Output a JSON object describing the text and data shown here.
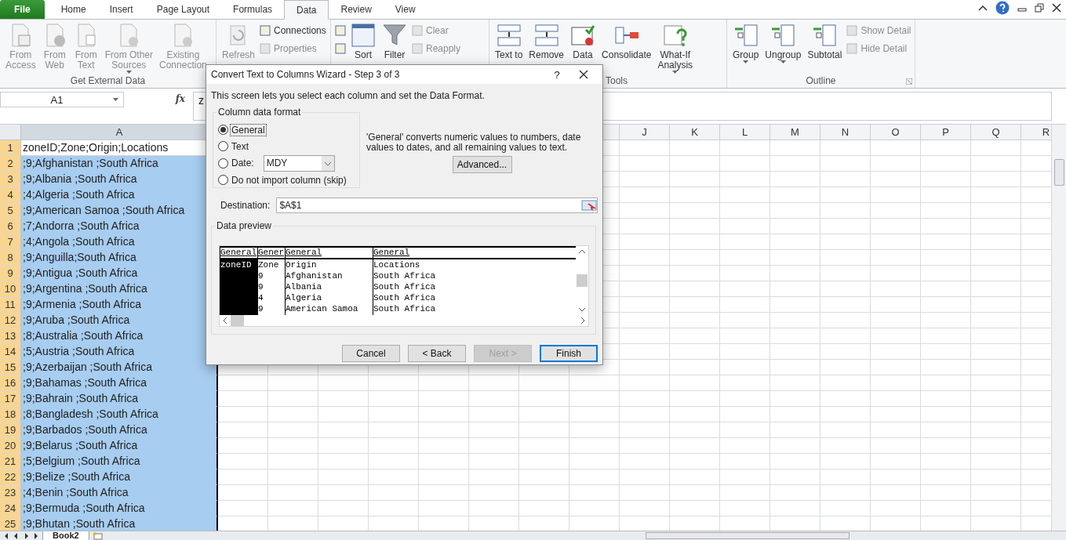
{
  "tabs": [
    {
      "label": "File",
      "kind": "file",
      "selected": false
    },
    {
      "label": "Home",
      "kind": "tab",
      "selected": false
    },
    {
      "label": "Insert",
      "kind": "tab",
      "selected": false
    },
    {
      "label": "Page Layout",
      "kind": "tab",
      "selected": false
    },
    {
      "label": "Formulas",
      "kind": "tab",
      "selected": false
    },
    {
      "label": "Data",
      "kind": "tab",
      "selected": true
    },
    {
      "label": "Review",
      "kind": "tab",
      "selected": false
    },
    {
      "label": "View",
      "kind": "tab",
      "selected": false
    }
  ],
  "ribbon": {
    "groups": [
      {
        "label": "Get External Data",
        "items": [
          {
            "kind": "large",
            "label": "From\nAccess",
            "disabled": true
          },
          {
            "kind": "large",
            "label": "From\nWeb",
            "disabled": true
          },
          {
            "kind": "large",
            "label": "From\nText",
            "disabled": true
          },
          {
            "kind": "large",
            "label": "From Other\nSources",
            "disabled": true,
            "caret": true
          },
          {
            "kind": "large",
            "label": "Existing\nConnection",
            "disabled": true
          }
        ]
      },
      {
        "items": [
          {
            "kind": "large",
            "label": "Refresh",
            "disabled": true
          },
          {
            "kind": "stack",
            "items": [
              {
                "label": "Connections",
                "disabled": false
              },
              {
                "label": "Properties",
                "disabled": true
              }
            ]
          }
        ]
      },
      {
        "items": [
          {
            "kind": "stack",
            "items": [
              {
                "disabled": false
              },
              {
                "disabled": false
              }
            ]
          },
          {
            "kind": "large",
            "label": "Sort",
            "disabled": false
          },
          {
            "kind": "large",
            "label": "Filter",
            "disabled": false
          },
          {
            "kind": "stack",
            "items": [
              {
                "label": "Clear",
                "disabled": true
              },
              {
                "label": "Reapply",
                "disabled": true
              }
            ]
          }
        ]
      },
      {
        "label": "Tools",
        "items": [
          {
            "kind": "large",
            "label": "Text to",
            "disabled": false
          },
          {
            "kind": "large",
            "label": "Remove",
            "disabled": false
          },
          {
            "kind": "large",
            "label": "Data",
            "disabled": false
          },
          {
            "kind": "large",
            "label": "Consolidate",
            "disabled": false
          },
          {
            "kind": "large",
            "label": "What-If\nAnalysis",
            "disabled": false,
            "caret": true
          }
        ]
      },
      {
        "label": "Outline",
        "launcher": true,
        "items": [
          {
            "kind": "large",
            "label": "Group",
            "disabled": false,
            "caret": true
          },
          {
            "kind": "large",
            "label": "Ungroup",
            "disabled": false,
            "caret": true
          },
          {
            "kind": "large",
            "label": "Subtotal",
            "disabled": false
          },
          {
            "kind": "stack",
            "items": [
              {
                "label": "Show Detail",
                "disabled": true
              },
              {
                "label": "Hide Detail",
                "disabled": true
              }
            ]
          }
        ]
      }
    ]
  },
  "formula_bar": {
    "name_box": "A1",
    "fx": "fx",
    "content": "z"
  },
  "columns": [
    {
      "label": "A",
      "selected": true
    },
    {
      "label": "J",
      "selected": false
    },
    {
      "label": "K",
      "selected": false
    },
    {
      "label": "L",
      "selected": false
    },
    {
      "label": "M",
      "selected": false
    },
    {
      "label": "N",
      "selected": false
    },
    {
      "label": "O",
      "selected": false
    },
    {
      "label": "P",
      "selected": false
    },
    {
      "label": "Q",
      "selected": false
    },
    {
      "label": "R",
      "selected": false
    }
  ],
  "rows": [
    {
      "number": "1",
      "value": "zoneID;Zone;Origin;Locations",
      "selected": true,
      "active": true
    },
    {
      "number": "2",
      "value": ";9;Afghanistan ;South Africa",
      "selected": true,
      "active": false
    },
    {
      "number": "3",
      "value": ";9;Albania ;South Africa",
      "selected": true,
      "active": false
    },
    {
      "number": "4",
      "value": ";4;Algeria ;South Africa",
      "selected": true,
      "active": false
    },
    {
      "number": "5",
      "value": ";9;American Samoa ;South Africa",
      "selected": true,
      "active": false
    },
    {
      "number": "6",
      "value": ";7;Andorra ;South Africa",
      "selected": true,
      "active": false
    },
    {
      "number": "7",
      "value": ";4;Angola ;South Africa",
      "selected": true,
      "active": false
    },
    {
      "number": "8",
      "value": ";9;Anguilla;South Africa",
      "selected": true,
      "active": false
    },
    {
      "number": "9",
      "value": ";9;Antigua ;South Africa",
      "selected": true,
      "active": false
    },
    {
      "number": "10",
      "value": ";9;Argentina ;South Africa",
      "selected": true,
      "active": false
    },
    {
      "number": "11",
      "value": ";9;Armenia ;South Africa",
      "selected": true,
      "active": false
    },
    {
      "number": "12",
      "value": ";9;Aruba ;South Africa",
      "selected": true,
      "active": false
    },
    {
      "number": "13",
      "value": ";8;Australia ;South Africa",
      "selected": true,
      "active": false
    },
    {
      "number": "14",
      "value": ";5;Austria ;South Africa",
      "selected": true,
      "active": false
    },
    {
      "number": "15",
      "value": ";9;Azerbaijan ;South Africa",
      "selected": true,
      "active": false
    },
    {
      "number": "16",
      "value": ";9;Bahamas ;South Africa",
      "selected": true,
      "active": false
    },
    {
      "number": "17",
      "value": ";9;Bahrain ;South Africa",
      "selected": true,
      "active": false
    },
    {
      "number": "18",
      "value": ";8;Bangladesh ;South Africa",
      "selected": true,
      "active": false
    },
    {
      "number": "19",
      "value": ";9;Barbados ;South Africa",
      "selected": true,
      "active": false
    },
    {
      "number": "20",
      "value": ";9;Belarus ;South Africa",
      "selected": true,
      "active": false
    },
    {
      "number": "21",
      "value": ";5;Belgium ;South Africa",
      "selected": true,
      "active": false
    },
    {
      "number": "22",
      "value": ";9;Belize ;South Africa",
      "selected": true,
      "active": false
    },
    {
      "number": "23",
      "value": ";4;Benin ;South Africa",
      "selected": true,
      "active": false
    },
    {
      "number": "24",
      "value": ";9;Bermuda ;South Africa",
      "selected": true,
      "active": false
    },
    {
      "number": "25",
      "value": ";9;Bhutan ;South Africa",
      "selected": true,
      "active": false
    }
  ],
  "sheet_tabs": [
    {
      "label": "Book2",
      "selected": true
    }
  ],
  "dialog": {
    "title": "Convert Text to Columns Wizard - Step 3 of 3",
    "help": "?",
    "intro": "This screen lets you select each column and set the Data Format.",
    "format_group": "Column data format",
    "options": [
      {
        "label": "General",
        "selected": true
      },
      {
        "label": "Text",
        "selected": false
      },
      {
        "label": "Date:",
        "selected": false,
        "select_value": "MDY"
      },
      {
        "label": "Do not import column (skip)",
        "selected": false
      }
    ],
    "description": "'General' converts numeric values to numbers, date values to dates, and all remaining values to text.",
    "advanced": "Advanced...",
    "destination_label": "Destination:",
    "destination": "$A$1",
    "preview_label": "Data preview",
    "preview": [
      {
        "header": "General",
        "selected": true,
        "values": [
          "zoneID"
        ]
      },
      {
        "header": "Gener",
        "selected": false,
        "values": [
          "Zone",
          "9",
          "9",
          "4",
          "9"
        ]
      },
      {
        "header": "General",
        "selected": false,
        "values": [
          "Origin",
          "Afghanistan",
          "Albania",
          "Algeria",
          "American Samoa"
        ]
      },
      {
        "header": "General",
        "selected": false,
        "values": [
          "Locations",
          "South Africa",
          "South Africa",
          "South Africa",
          "South Africa"
        ]
      }
    ],
    "buttons": [
      {
        "label": "Cancel",
        "disabled": false,
        "default": false
      },
      {
        "label": "< Back",
        "disabled": false,
        "default": false
      },
      {
        "label": "Next >",
        "disabled": true,
        "default": false
      },
      {
        "label": "Finish",
        "disabled": false,
        "default": true
      }
    ]
  }
}
